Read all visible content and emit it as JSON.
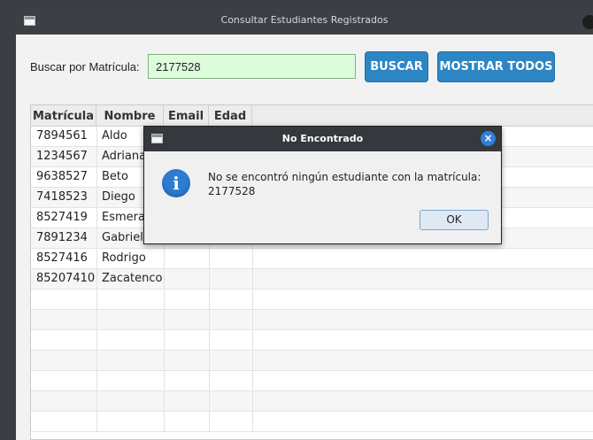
{
  "window": {
    "title": "Consultar Estudiantes Registrados"
  },
  "search": {
    "label": "Buscar por Matrícula:",
    "value": "2177528",
    "buscar_label": "BUSCAR",
    "mostrar_label": "MOSTRAR TODOS"
  },
  "table": {
    "headers": [
      "Matrícula",
      "Nombre",
      "Email",
      "Edad"
    ],
    "rows": [
      [
        "7894561",
        "Aldo",
        "",
        ""
      ],
      [
        "1234567",
        "Adriana",
        "",
        ""
      ],
      [
        "9638527",
        "Beto",
        "",
        ""
      ],
      [
        "7418523",
        "Diego",
        "",
        ""
      ],
      [
        "8527419",
        "Esmeralda",
        "",
        ""
      ],
      [
        "7891234",
        "Gabriela",
        "",
        ""
      ],
      [
        "8527416",
        "Rodrigo",
        "",
        ""
      ],
      [
        "85207410",
        "Zacatenco",
        "",
        ""
      ]
    ]
  },
  "dialog": {
    "title": "No Encontrado",
    "message_line1": "No se encontró ningún estudiante con la matrícula:",
    "message_line2": "2177528",
    "ok_label": "OK",
    "close_glyph": "×",
    "info_glyph": "i"
  },
  "colors": {
    "accent_blue": "#2d86c4",
    "search_bg": "#ddfcdc",
    "titlebar": "#3c3f45"
  },
  "icons": [
    "window-icon",
    "info-icon",
    "close-icon"
  ]
}
